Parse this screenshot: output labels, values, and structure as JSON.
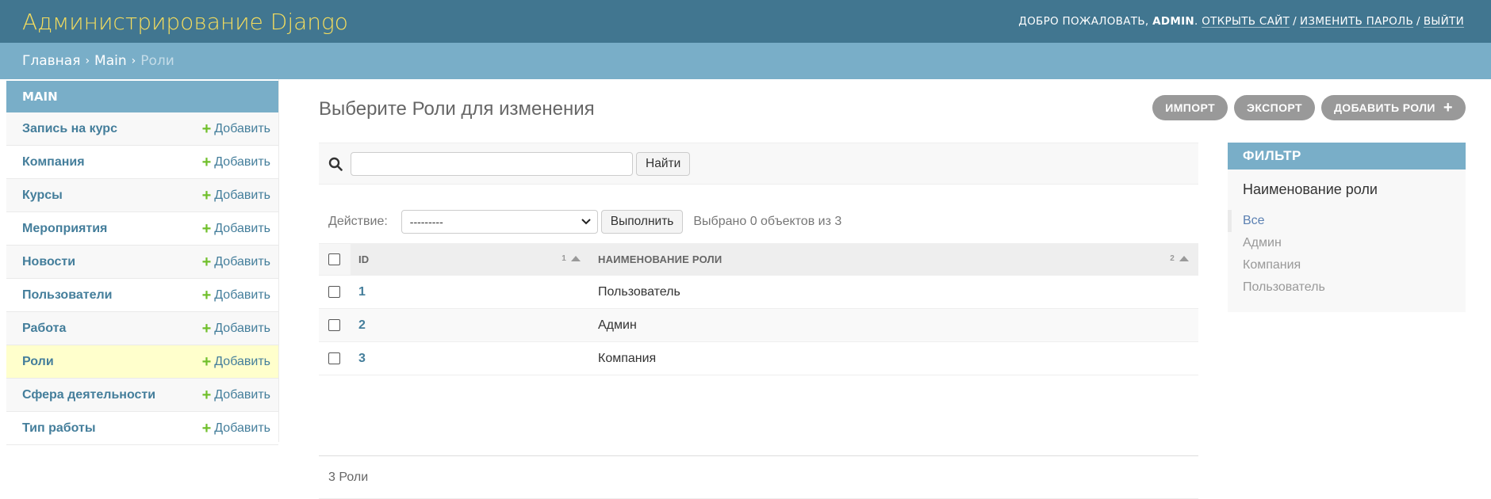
{
  "header": {
    "site_title": "Администрирование Django",
    "welcome": "ДОБРО ПОЖАЛОВАТЬ,",
    "username": "ADMIN",
    "links": [
      "ОТКРЫТЬ САЙТ",
      "ИЗМЕНИТЬ ПАРОЛЬ",
      "ВЫЙТИ"
    ]
  },
  "breadcrumbs": {
    "home": "Главная",
    "app": "Main",
    "current": "Роли"
  },
  "sidebar": {
    "caption": "MAIN",
    "add_label": "Добавить",
    "current_index": 7,
    "models": [
      {
        "name": "Запись на курс"
      },
      {
        "name": "Компания"
      },
      {
        "name": "Курсы"
      },
      {
        "name": "Мероприятия"
      },
      {
        "name": "Новости"
      },
      {
        "name": "Пользователи"
      },
      {
        "name": "Работа"
      },
      {
        "name": "Роли"
      },
      {
        "name": "Сфера деятельности"
      },
      {
        "name": "Тип работы"
      }
    ]
  },
  "main": {
    "title": "Выберите Роли для изменения",
    "object_tools": {
      "import": "ИМПОРТ",
      "export": "ЭКСПОРТ",
      "add": "ДОБАВИТЬ РОЛИ"
    },
    "search": {
      "value": "",
      "button": "Найти"
    },
    "actions": {
      "label": "Действие:",
      "selected_value": "---------",
      "execute": "Выполнить",
      "counter": "Выбрано 0 объектов из 3"
    },
    "table": {
      "columns": [
        {
          "label": "ID",
          "sort_priority": "1"
        },
        {
          "label": "НАИМЕНОВАНИЕ РОЛИ",
          "sort_priority": "2"
        }
      ],
      "rows": [
        {
          "id": "1",
          "name": "Пользователь"
        },
        {
          "id": "2",
          "name": "Админ"
        },
        {
          "id": "3",
          "name": "Компания"
        }
      ]
    },
    "paginator": "3 Роли"
  },
  "filter": {
    "title": "ФИЛЬТР",
    "field": "Наименование роли",
    "options": [
      {
        "label": "Все",
        "selected": true
      },
      {
        "label": "Админ",
        "selected": false
      },
      {
        "label": "Компания",
        "selected": false
      },
      {
        "label": "Пользователь",
        "selected": false
      }
    ]
  },
  "colors": {
    "header_bg": "#417690",
    "breadcrumb_bg": "#79aec8",
    "site_title": "#f5dd5d",
    "link": "#447e9b",
    "add_plus": "#70bf2b",
    "current_row": "#ffffcc"
  },
  "icons": [
    "search-icon",
    "plus-icon",
    "chevron-down-icon"
  ]
}
